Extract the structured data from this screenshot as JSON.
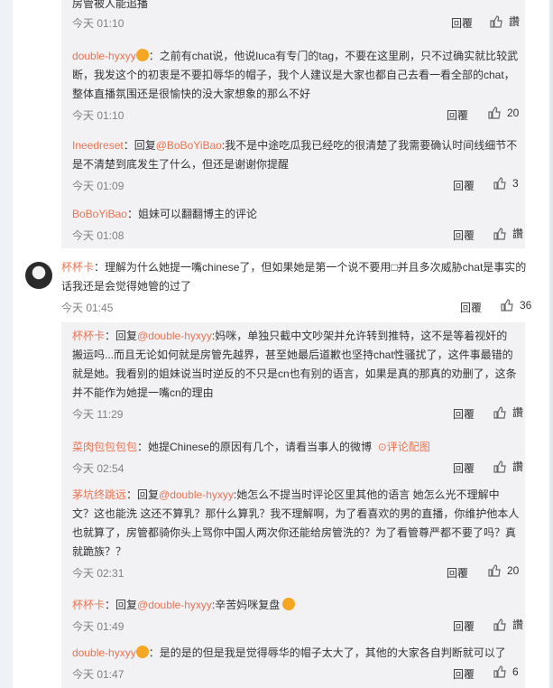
{
  "comments": [
    {
      "user": "",
      "text": "房管被人能追播",
      "time": "今天 01:10",
      "reply": "回覆",
      "like": ""
    },
    {
      "user": "double-hyxyy",
      "text": "：之前有chat说，他说luca有专门的tag，不要在这里刷，只不过确实就比较武断，我发这个的初衷是不要扣辱华的帽子，我个人建议是大家也都自己去看一看全部的chat，整体直播氛围还是很愉快的没大家想象的那么不好",
      "time": "今天 01:10",
      "reply": "回覆",
      "like": "20"
    },
    {
      "user": "Ineedreset",
      "prefix": "：回复",
      "mention": "@BoBoYiBao",
      "text": ":我不是中途吃瓜我已经吃的很清楚了我需要确认时间线细节不是不清楚到底发生了什么，但还是谢谢你提醒",
      "time": "今天 01:09",
      "reply": "回覆",
      "like": "3"
    },
    {
      "user": "BoBoYiBao",
      "text": "：姐妹可以翻翻博主的评论",
      "time": "今天 01:08",
      "reply": "回覆",
      "like": "讚"
    }
  ],
  "main_comment": {
    "user": "杯杯卡",
    "text": "：理解为什么她提一嘴chinese了，但如果她是第一个说不要用□并且多次威胁chat是事实的话我还是会觉得她管的过了",
    "time": "今天 01:45",
    "reply": "回覆",
    "like": "36"
  },
  "replies": [
    {
      "user": "杯杯卡",
      "prefix": "：回复",
      "mention": "@double-hyxyy",
      "text": ":妈咪，单独只截中文吵架并允许转到推特，这不是等着视奸的 搬运吗...而且无论如何就是房管先越界，甚至她最后道歉也坚持chat性骚扰了，这件事最错的就是她。我看别的姐妹说当时逆反的不只是cn也有别的语言，如果是真的那真的劝删了，这条并不能作为她提一嘴cn的理由",
      "time": "今天 11:29",
      "reply": "回覆",
      "like": "讚"
    },
    {
      "user": "菜肉包包包包",
      "text": "：她提Chinese的原因有几个，请看当事人的微博",
      "link": "评论配图",
      "time": "今天 02:54",
      "reply": "回覆",
      "like": "讚"
    },
    {
      "user": "茅坑终跳远",
      "prefix": "：回复",
      "mention": "@double-hyxyy",
      "text": ":她怎么不提当时评论区里其他的语言 她怎么光不理解中文？这也能洗 这还不算乳？那什么算乳？我不理解啊，为了看喜欢的男的直播，你维护他本人也就算了，房管都骑你头上骂你中国人两次你还能给房管洗的？为了看管尊严都不要了吗？真就跪族？？",
      "time": "今天 02:31",
      "reply": "回覆",
      "like": "20"
    },
    {
      "user": "杯杯卡",
      "prefix": "：回复",
      "mention": "@double-hyxyy",
      "text": ":辛苦妈咪复盘",
      "time": "今天 01:49",
      "reply": "回覆",
      "like": "讚"
    },
    {
      "user": "double-hyxyy",
      "text": "：是的是的但是我是觉得辱华的帽子太大了，其他的大家各自判断就可以了",
      "time": "今天 01:47",
      "reply": "回覆",
      "like": "6"
    }
  ]
}
